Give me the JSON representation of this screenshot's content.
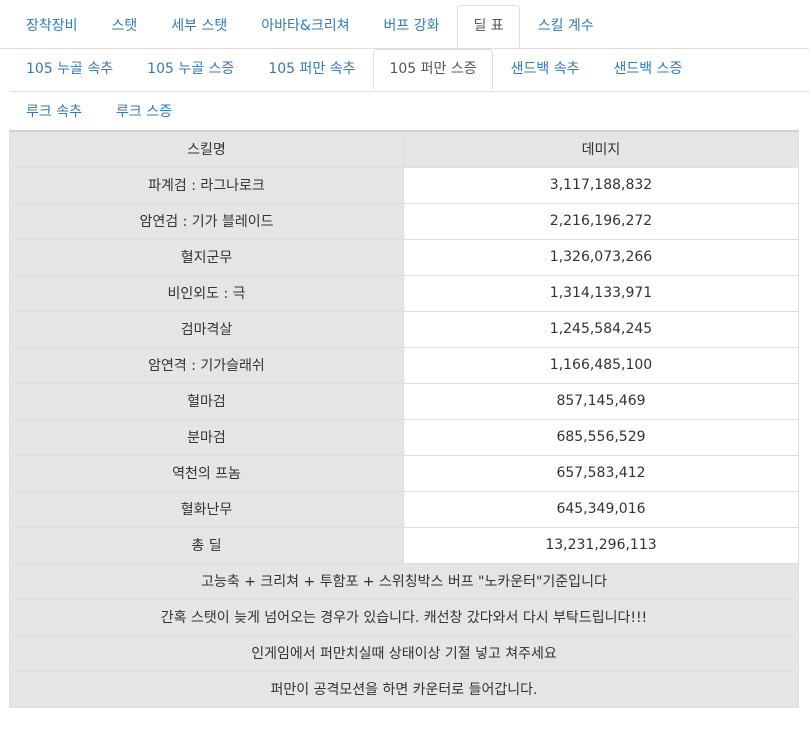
{
  "tabs_top": [
    {
      "label": "장착장비",
      "active": false
    },
    {
      "label": "스탯",
      "active": false
    },
    {
      "label": "세부 스탯",
      "active": false
    },
    {
      "label": "아바타&크리쳐",
      "active": false
    },
    {
      "label": "버프 강화",
      "active": false
    },
    {
      "label": "딜 표",
      "active": true
    },
    {
      "label": "스킬 계수",
      "active": false
    }
  ],
  "tabs_sub": [
    {
      "label": "105 누골 속추",
      "active": false
    },
    {
      "label": "105 누골 스증",
      "active": false
    },
    {
      "label": "105 퍼만 속추",
      "active": false
    },
    {
      "label": "105 퍼만 스증",
      "active": true
    },
    {
      "label": "샌드백 속추",
      "active": false
    },
    {
      "label": "샌드백 스증",
      "active": false
    },
    {
      "label": "루크 속추",
      "active": false
    },
    {
      "label": "루크 스증",
      "active": false
    }
  ],
  "table": {
    "headers": {
      "skill": "스킬명",
      "damage": "데미지"
    },
    "rows": [
      {
        "skill": "파계검 : 라그나로크",
        "damage": "3,117,188,832"
      },
      {
        "skill": "암연검 : 기가 블레이드",
        "damage": "2,216,196,272"
      },
      {
        "skill": "혈지군무",
        "damage": "1,326,073,266"
      },
      {
        "skill": "비인외도 : 극",
        "damage": "1,314,133,971"
      },
      {
        "skill": "검마격살",
        "damage": "1,245,584,245"
      },
      {
        "skill": "암연격 : 기가슬래쉬",
        "damage": "1,166,485,100"
      },
      {
        "skill": "혈마검",
        "damage": "857,145,469"
      },
      {
        "skill": "분마검",
        "damage": "685,556,529"
      },
      {
        "skill": "역천의 프놈",
        "damage": "657,583,412"
      },
      {
        "skill": "혈화난무",
        "damage": "645,349,016"
      },
      {
        "skill": "총 딜",
        "damage": "13,231,296,113"
      }
    ],
    "notes": [
      "고능축 + 크리쳐 + 투함포 + 스위칭박스 버프 \"노카운터\"기준입니다",
      "간혹 스탯이 늦게 넘어오는 경우가 있습니다. 캐선창 갔다와서 다시 부탁드립니다!!!",
      "인게임에서 퍼만치실때 상태이상 기절 넣고 쳐주세요",
      "퍼만이 공격모션을 하면 카운터로 들어갑니다."
    ]
  }
}
